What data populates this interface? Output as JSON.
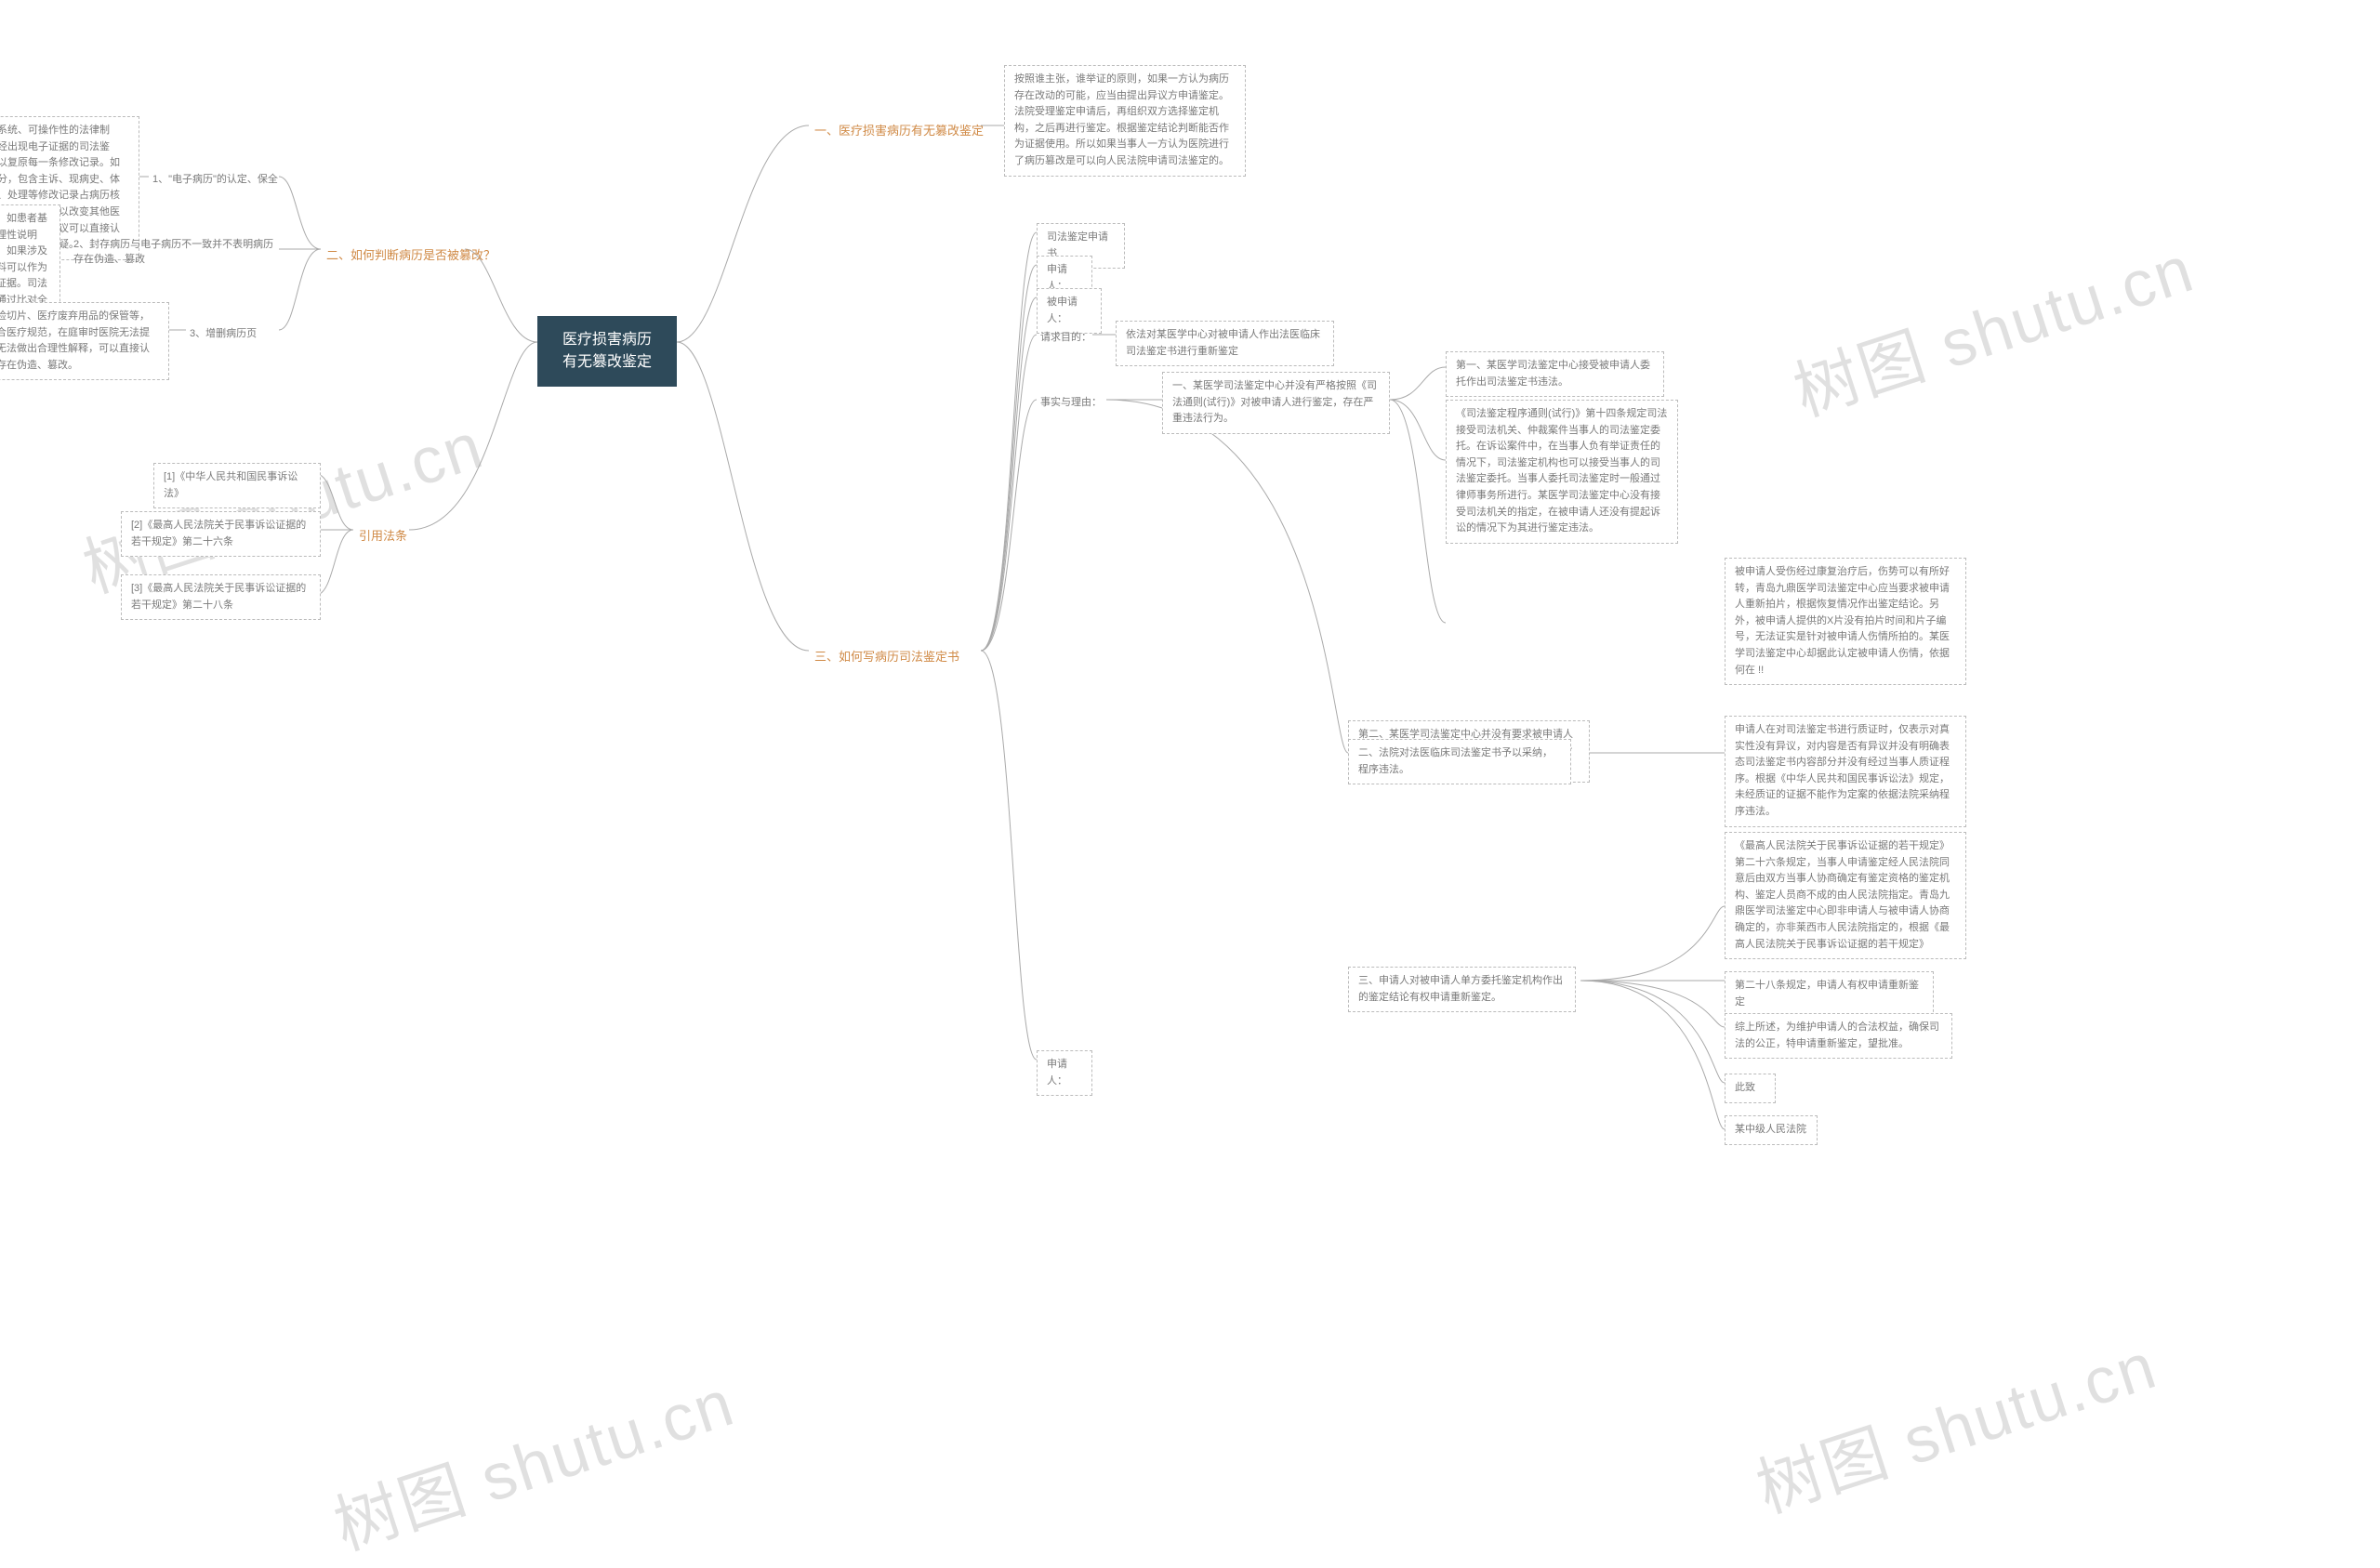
{
  "root": "医疗损害病历有无篡改鉴定",
  "branches": {
    "b1": "一、医疗损害病历有无篡改鉴定",
    "b2": "二、如何判断病历是否被篡改？",
    "b3": "三、如何写病历司法鉴定书",
    "b4": "引用法条"
  },
  "b1_box": "按照谁主张，谁举证的原则，如果一方认为病历存在改动的可能，应当由提出异议方申请鉴定。法院受理鉴定申请后，再组织双方选择鉴定机构，之后再进行鉴定。根据鉴定结论判断能否作为证据使用。所以如果当事人一方认为医院进行了病历篡改是可以向人民法院申请司法鉴定的。",
  "b2_items": {
    "i1": "1、\"电子病历\"的认定、保全",
    "i2": "2、封存病历与电子病历不一致并不表明病历存在伪造、篡改",
    "i3": "3、增删病历页"
  },
  "b2_boxes": {
    "x1": "虽然没有建立系统、可操作性的法律制度，但目前已经出现电子证据的司法鉴定，该鉴定可以复原每一条修改记录。如果病历核心部分，包含主诉、现病史、体格检查、诊断、处理等修改记录占病历核心部分全部的10%以上，足以改变其他医疗人员对疾病认知，笔者建议可以直接认定病历存在伪造、篡改的嫌疑。",
    "x2": "如果不存在关键实质性部分的修改，如患者基本信息、既往史等，医方能给予合理性说明的，笔者建议能够确认病历真实性。如果涉及实质性的地方改动，那么影像学资料可以作为疾病诊断以及治疗效果的唯一确切证据。司法鉴定机构可以影像学资料为基础，通过比对全病历，分析疾病的修改部分做出合理性怀疑意见提供给法官。",
    "x3": "包括病检切片、医疗废弃用品的保管等，如不符合医疗规范，在庭审时医院无法提供，且无法做出合理性解释，可以直接认定病历存在伪造、篡改。"
  },
  "b3_items": {
    "s1": "司法鉴定申请书",
    "s2": "申请人：",
    "s3": "被申请人：",
    "s4": "请求目的：",
    "s4_box": "依法对某医学中心对被申请人作出法医临床司法鉴定书进行重新鉴定",
    "s5": "事实与理由：",
    "s6": "申请人："
  },
  "b3_r1": {
    "t": "一、某医学司法鉴定中心并没有严格按照《司法通则(试行)》对被申请人进行鉴定，存在严重违法行为。",
    "a": "第一、某医学司法鉴定中心接受被申请人委托作出司法鉴定书违法。",
    "b": "《司法鉴定程序通则(试行)》第十四条规定司法接受司法机关、仲裁案件当事人的司法鉴定委托。在诉讼案件中，在当事人负有举证责任的情况下，司法鉴定机构也可以接受当事人的司法鉴定委托。当事人委托司法鉴定时一般通过律师事务所进行。某医学司法鉴定中心没有接受司法机关的指定，在被申请人还没有提起诉讼的情况下为其进行鉴定违法。",
    "c": "第二、某医学司法鉴定中心并没有要求被申请人重新拍片确认伤情，依据没有注明拍片时间和片子编号的X片作出鉴定结论违法。",
    "c1": "被申请人受伤经过康复治疗后，伤势可以有所好转，青岛九鼎医学司法鉴定中心应当要求被申请人重新拍片，根据恢复情况作出鉴定结论。另外，被申请人提供的X片没有拍片时间和片子编号，无法证实是针对被申请人伤情所拍的。某医学司法鉴定中心却据此认定被申请人伤情，依据何在 !!"
  },
  "b3_r2": {
    "t": "二、法院对法医临床司法鉴定书予以采纳，程序违法。",
    "a": "申请人在对司法鉴定书进行质证时，仅表示对真实性没有异议，对内容是否有异议并没有明确表态司法鉴定书内容部分并没有经过当事人质证程序。根据《中华人民共和国民事诉讼法》规定，未经质证的证据不能作为定案的依据法院采纳程序违法。"
  },
  "b3_r3": {
    "t": "三、申请人对被申请人单方委托鉴定机构作出的鉴定结论有权申请重新鉴定。",
    "a": "《最高人民法院关于民事诉讼证据的若干规定》第二十六条规定，当事人申请鉴定经人民法院同意后由双方当事人协商确定有鉴定资格的鉴定机构、鉴定人员商不成的由人民法院指定。青岛九鼎医学司法鉴定中心即非申请人与被申请人协商确定的，亦非莱西市人民法院指定的，根据《最高人民法院关于民事诉讼证据的若干规定》",
    "b": "第二十八条规定，申请人有权申请重新鉴定",
    "c": "综上所述，为维护申请人的合法权益，确保司法的公正，特申请重新鉴定，望批准。",
    "d": "此致",
    "e": "某中级人民法院"
  },
  "b4_items": {
    "l1": "[1]《中华人民共和国民事诉讼法》",
    "l2": "[2]《最高人民法院关于民事诉讼证据的若干规定》第二十六条",
    "l3": "[3]《最高人民法院关于民事诉讼证据的若干规定》第二十八条"
  },
  "watermarks": {
    "w1": "树图 shutu.cn",
    "w2": "树图 shutu.cn",
    "w3": "树图 shutu.cn",
    "w4": "树图 shutu.cn"
  }
}
